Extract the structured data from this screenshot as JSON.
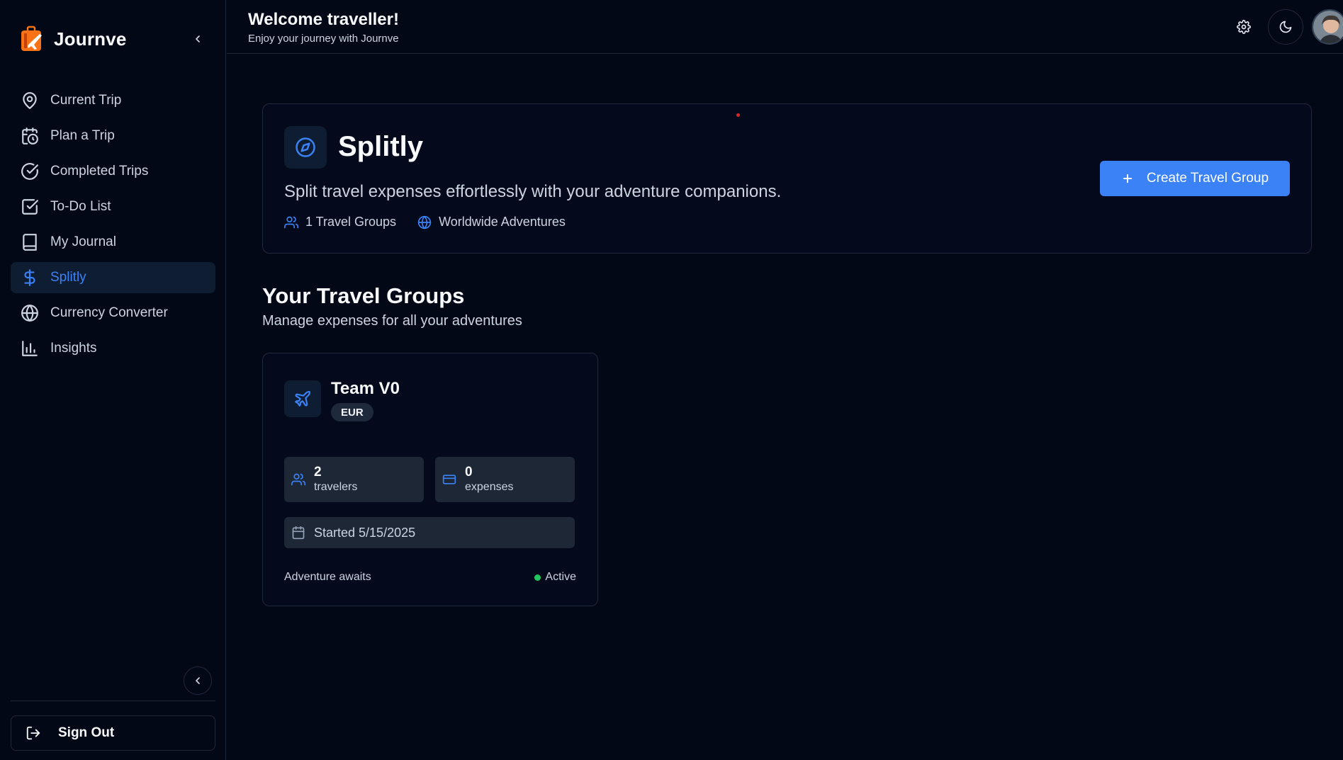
{
  "brand": {
    "name": "Journve"
  },
  "sidebar": {
    "items": [
      {
        "label": "Current Trip",
        "icon": "map-pin-icon"
      },
      {
        "label": "Plan a Trip",
        "icon": "calendar-clock-icon"
      },
      {
        "label": "Completed Trips",
        "icon": "check-circle-icon"
      },
      {
        "label": "To-Do List",
        "icon": "check-square-icon"
      },
      {
        "label": "My Journal",
        "icon": "book-icon"
      },
      {
        "label": "Splitly",
        "icon": "dollar-icon",
        "active": true
      },
      {
        "label": "Currency Converter",
        "icon": "globe-icon"
      },
      {
        "label": "Insights",
        "icon": "bar-chart-icon"
      }
    ],
    "sign_out": "Sign Out"
  },
  "header": {
    "title": "Welcome traveller!",
    "subtitle": "Enjoy your journey with Journve"
  },
  "hero": {
    "title": "Splitly",
    "description": "Split travel expenses effortlessly with your adventure companions.",
    "groups_count": "1 Travel Groups",
    "scope": "Worldwide Adventures",
    "create_button": "Create Travel Group"
  },
  "groups_section": {
    "title": "Your Travel Groups",
    "subtitle": "Manage expenses for all your adventures",
    "groups": [
      {
        "name": "Team V0",
        "currency": "EUR",
        "travelers_count": "2",
        "travelers_label": "travelers",
        "expenses_count": "0",
        "expenses_label": "expenses",
        "started": "Started 5/15/2025",
        "tagline": "Adventure awaits",
        "status": "Active"
      }
    ]
  },
  "colors": {
    "background": "#030817",
    "accent": "#3b82f6",
    "border": "#1e293b",
    "status_active": "#22c55e"
  }
}
